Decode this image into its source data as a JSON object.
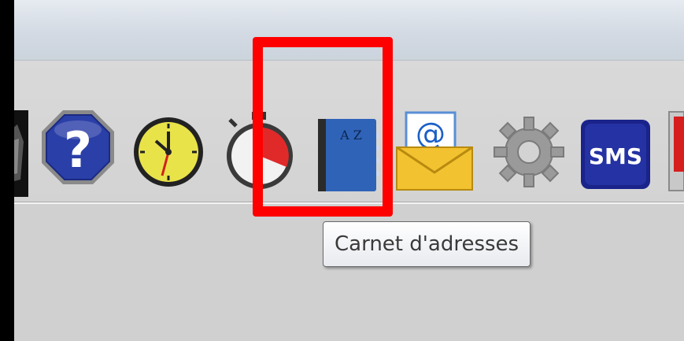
{
  "toolbar": {
    "items": [
      {
        "name": "partial-icon",
        "icon": "dark-partial-icon"
      },
      {
        "name": "help",
        "icon": "help-octagon-icon"
      },
      {
        "name": "clock",
        "icon": "clock-icon"
      },
      {
        "name": "timer",
        "icon": "stopwatch-icon"
      },
      {
        "name": "address-book",
        "icon": "address-book-icon",
        "highlighted": true,
        "cover_text": "A Z"
      },
      {
        "name": "mail",
        "icon": "email-envelope-icon",
        "at_sign": "@"
      },
      {
        "name": "settings",
        "icon": "gear-icon"
      },
      {
        "name": "sms",
        "icon": "sms-icon",
        "text": "SMS"
      },
      {
        "name": "partial-edge",
        "icon": "red-partial-icon"
      }
    ]
  },
  "tooltip": {
    "text": "Carnet d'adresses"
  },
  "colors": {
    "highlight": "#ff0000",
    "help": "#2b3fa8",
    "sms": "#2432a3",
    "clock_face": "#e9e34a",
    "book": "#2f63b8"
  }
}
